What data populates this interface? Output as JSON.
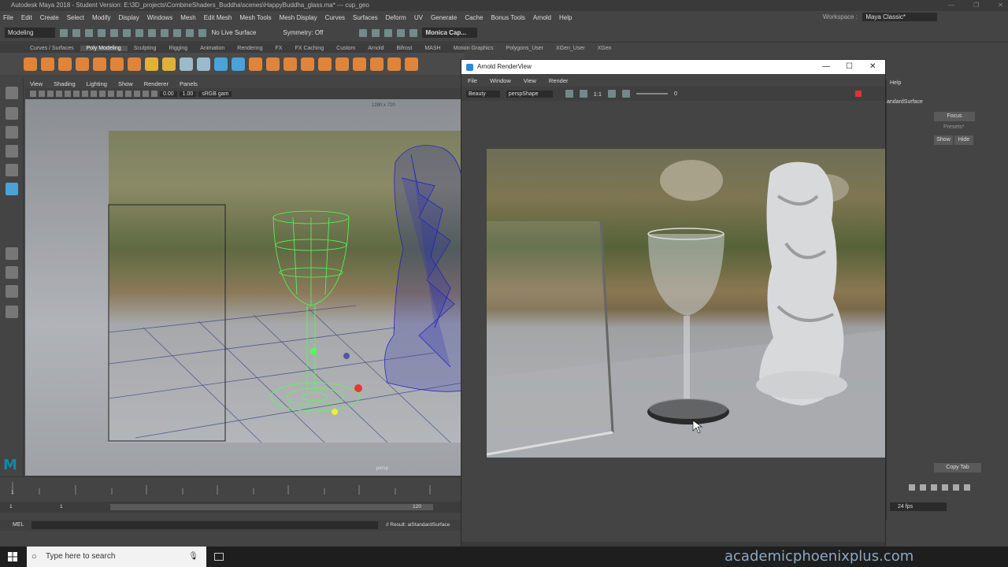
{
  "window": {
    "title": "Autodesk Maya 2018 - Student Version: E:\\3D_projects\\CombineShaders_Buddha\\scenes\\HappyBuddha_glass.ma* --- cup_geo"
  },
  "menubar": {
    "items": [
      "File",
      "Edit",
      "Create",
      "Select",
      "Modify",
      "Display",
      "Windows",
      "Mesh",
      "Edit Mesh",
      "Mesh Tools",
      "Mesh Display",
      "Curves",
      "Surfaces",
      "Deform",
      "UV",
      "Generate",
      "Cache",
      "Bonus Tools",
      "Arnold",
      "Help"
    ],
    "workspace_label": "Workspace :",
    "workspace_value": "Maya Classic*"
  },
  "statusline": {
    "mode": "Modeling",
    "live_surface": "No Live Surface",
    "symmetry": "Symmetry: Off",
    "account": "Monica Cap..."
  },
  "shelf": {
    "tabs": [
      "Curves / Surfaces",
      "Poly Modeling",
      "Sculpting",
      "Rigging",
      "Animation",
      "Rendering",
      "FX",
      "FX Caching",
      "Custom",
      "Arnold",
      "Bifrost",
      "MASH",
      "Motion Graphics",
      "Polygons_User",
      "XGen_User",
      "XGen"
    ],
    "active_tab": "Poly Modeling"
  },
  "viewport": {
    "menu": [
      "View",
      "Shading",
      "Lighting",
      "Show",
      "Renderer",
      "Panels"
    ],
    "field1": "0.00",
    "field2": "1.00",
    "color_space": "sRGB gam",
    "resolution": "1280 x 720",
    "camera": "persp"
  },
  "timeline": {
    "start": "1",
    "range_start": "1",
    "range_inner": "1",
    "range_end": "120",
    "fps": "24 fps"
  },
  "cmdline": {
    "label": "MEL",
    "result": "// Result: aiStandardSurface"
  },
  "right_panel": {
    "focus": "Focus",
    "presets": "Presets*",
    "show": "Show",
    "hide": "Hide",
    "copy_tab": "Copy Tab",
    "help": "Help",
    "std": "andardSurface"
  },
  "render_view": {
    "title": "Arnold RenderView",
    "menu": [
      "File",
      "Window",
      "View",
      "Render"
    ],
    "aov": "Beauty",
    "camera": "perspShape",
    "ratio": "1:1",
    "exposure": "0"
  },
  "taskbar": {
    "search_placeholder": "Type here to search"
  },
  "watermark": "academicphoenixplus.com"
}
